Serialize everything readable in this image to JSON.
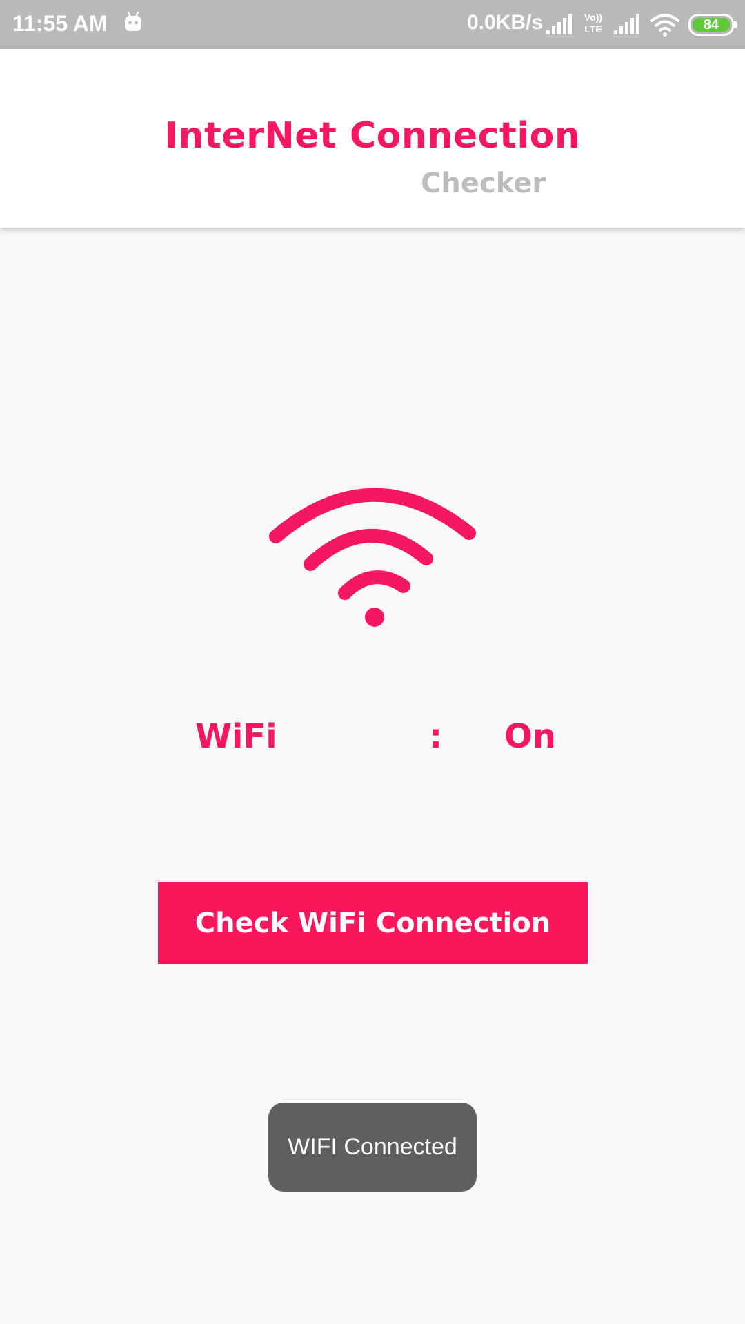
{
  "status_bar": {
    "time": "11:55 AM",
    "net_speed": "0.0KB/s",
    "lte_line1": "Vo))",
    "lte_line2": "LTE",
    "battery_level": "84",
    "battery_color": "#5fc93a",
    "icons": [
      "android-icon",
      "signal-icon",
      "lte-icon",
      "signal-icon",
      "wifi-icon",
      "battery-icon"
    ]
  },
  "header": {
    "title": "InterNet Connection",
    "subtitle": "Checker"
  },
  "main": {
    "icon": "wifi-icon",
    "status_label": "WiFi",
    "status_separator": ":",
    "status_value": "On",
    "check_button_label": "Check WiFi Connection"
  },
  "toast": {
    "message": "WIFI Connected"
  },
  "colors": {
    "accent": "#f5175f",
    "status_bar": "#b9b9b9",
    "toast_bg": "#5f5f5f"
  }
}
